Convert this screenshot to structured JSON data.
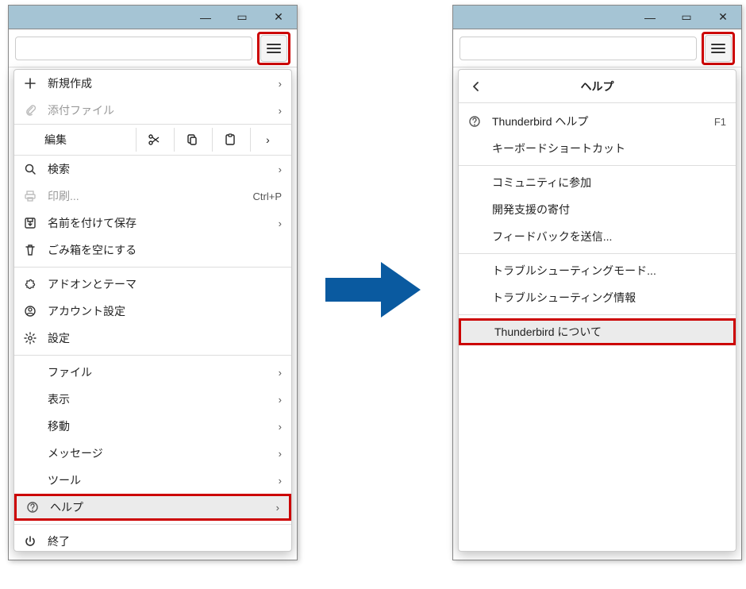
{
  "window_controls": {
    "minimize": "—",
    "maximize": "▭",
    "close": "✕"
  },
  "left_menu": {
    "new": "新規作成",
    "attach": "添付ファイル",
    "edit_label": "編集",
    "edit_buttons": {
      "cut": "cut",
      "copy": "copy",
      "paste": "paste",
      "more": ">"
    },
    "search": "検索",
    "print": {
      "label": "印刷...",
      "shortcut": "Ctrl+P"
    },
    "save_as": "名前を付けて保存",
    "empty_trash": "ごみ箱を空にする",
    "addons": "アドオンとテーマ",
    "account": "アカウント設定",
    "settings": "設定",
    "file": "ファイル",
    "view": "表示",
    "go": "移動",
    "message": "メッセージ",
    "tools": "ツール",
    "help": "ヘルプ",
    "quit": "終了"
  },
  "right_menu": {
    "header": "ヘルプ",
    "tb_help": {
      "label": "Thunderbird ヘルプ",
      "shortcut": "F1"
    },
    "keyboard": "キーボードショートカット",
    "community": "コミュニティに参加",
    "donate": "開発支援の寄付",
    "feedback": "フィードバックを送信...",
    "troubleshoot_mode": "トラブルシューティングモード...",
    "troubleshoot_info": "トラブルシューティング情報",
    "about": "Thunderbird について"
  }
}
